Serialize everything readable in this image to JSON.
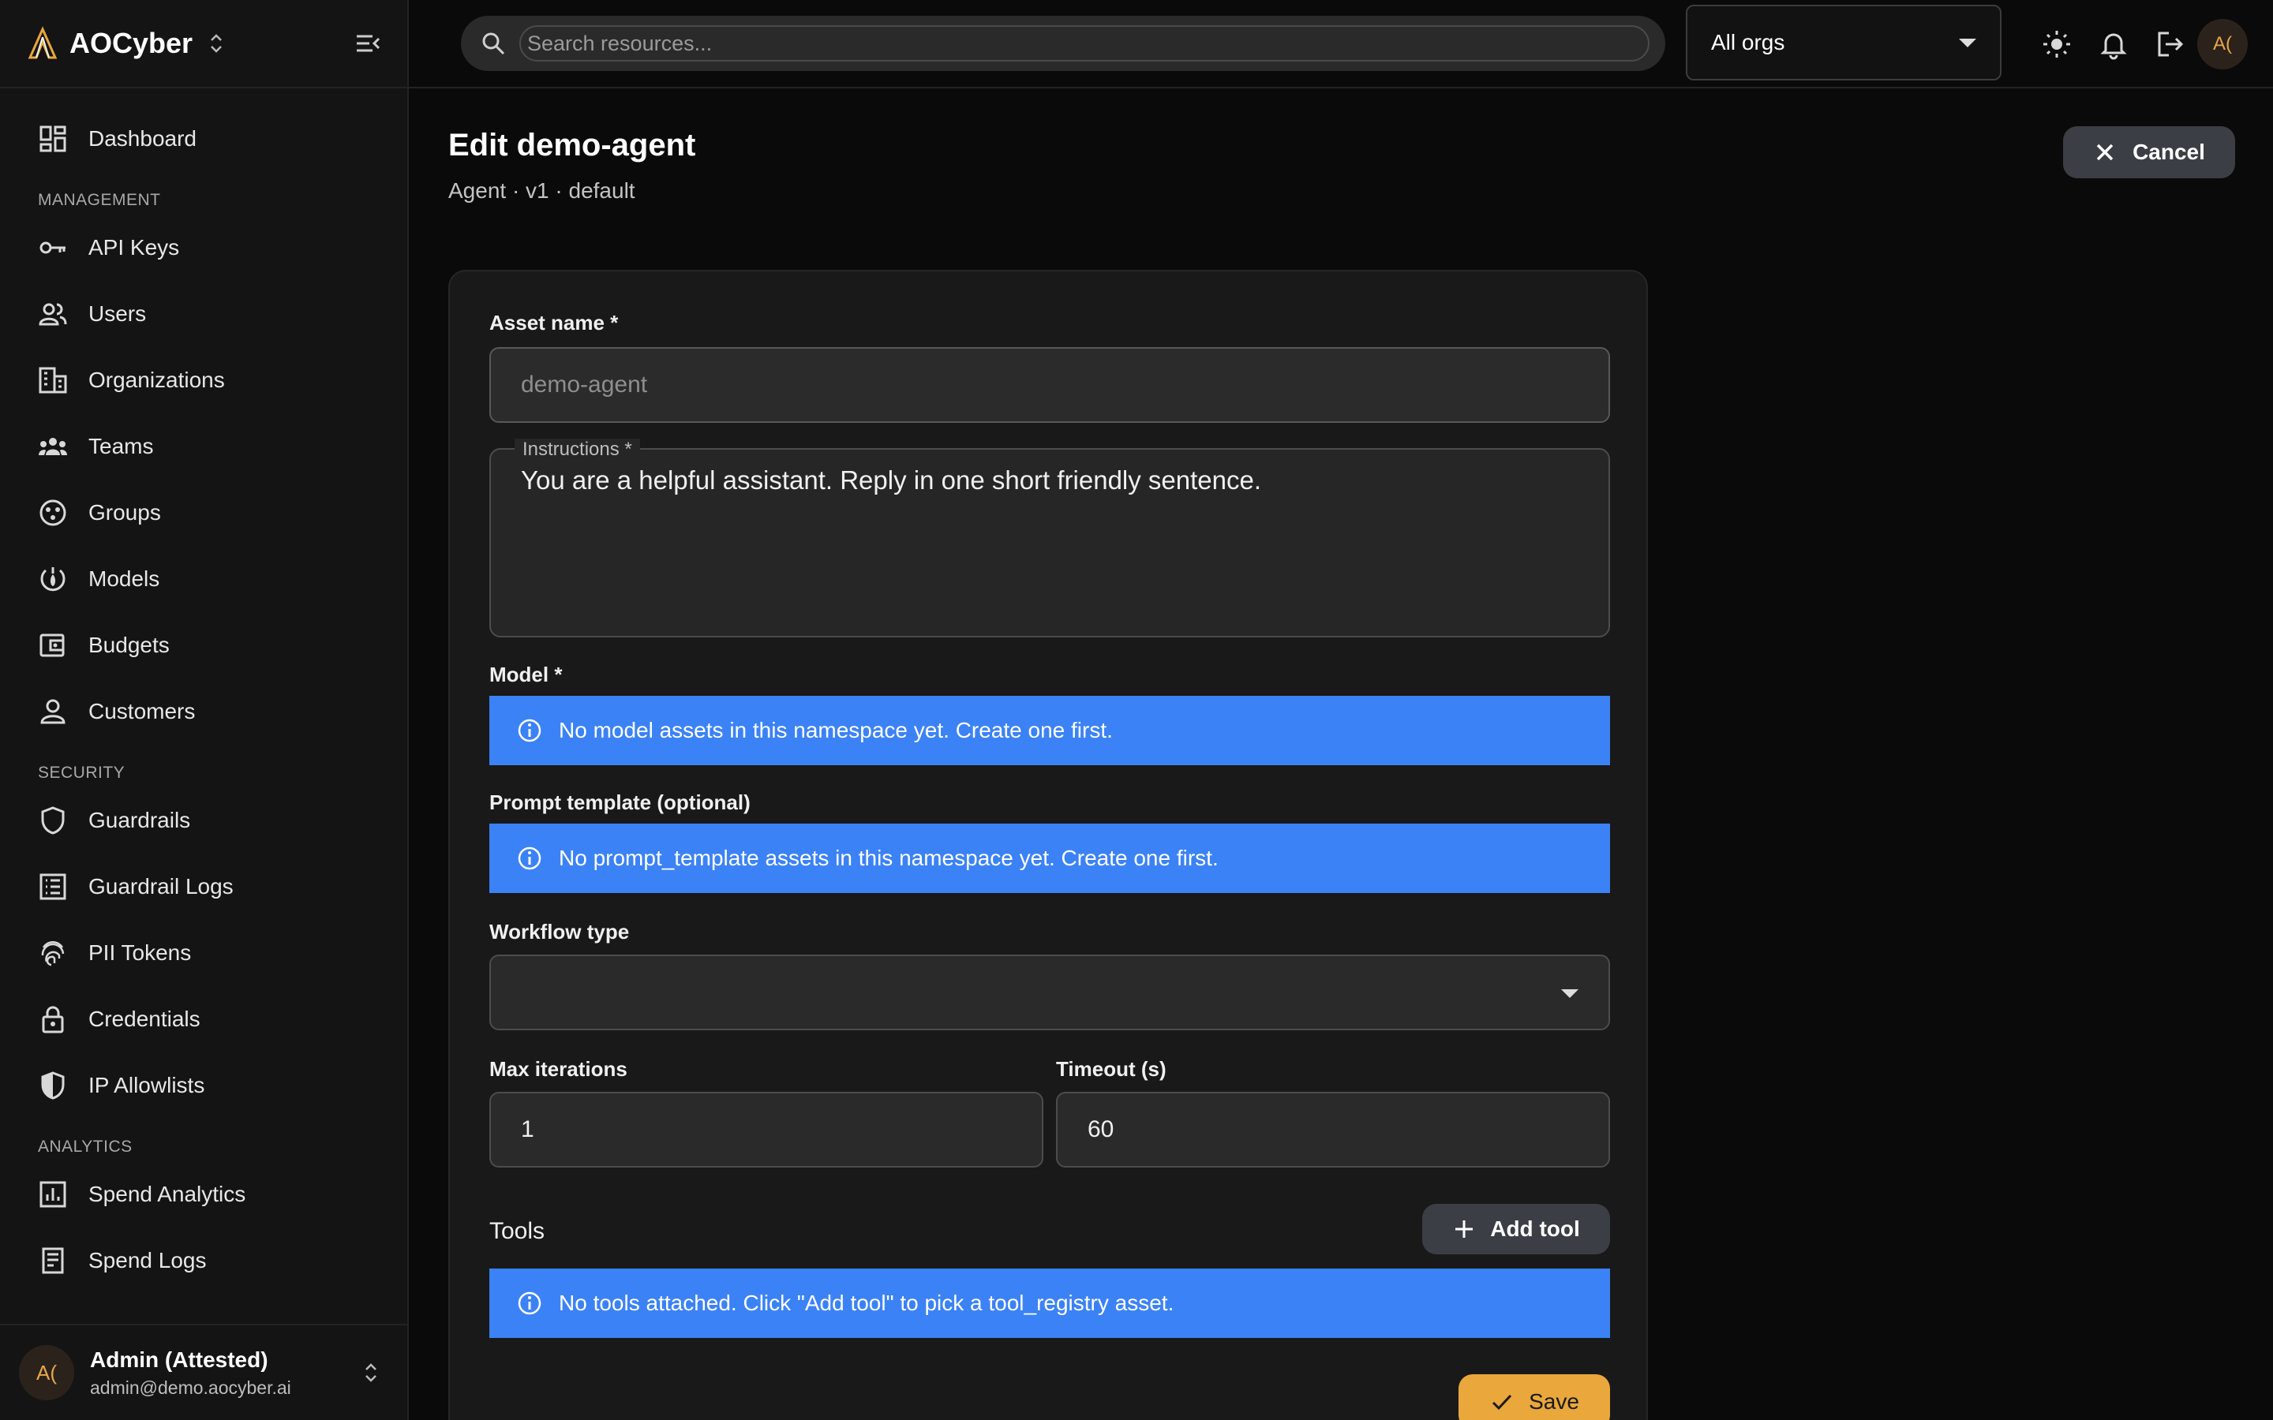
{
  "brand": {
    "name": "AOCyber",
    "switch_icon": "chevron-up-down-icon"
  },
  "sidebar": {
    "items": [
      {
        "label": "Dashboard",
        "icon": "dashboard-icon"
      }
    ],
    "sections": [
      {
        "title": "MANAGEMENT",
        "items": [
          {
            "label": "API Keys",
            "icon": "key-icon"
          },
          {
            "label": "Users",
            "icon": "users-icon"
          },
          {
            "label": "Organizations",
            "icon": "building-icon"
          },
          {
            "label": "Teams",
            "icon": "team-icon"
          },
          {
            "label": "Groups",
            "icon": "groups-icon"
          },
          {
            "label": "Models",
            "icon": "model-icon"
          },
          {
            "label": "Budgets",
            "icon": "wallet-icon"
          },
          {
            "label": "Customers",
            "icon": "person-icon"
          }
        ]
      },
      {
        "title": "SECURITY",
        "items": [
          {
            "label": "Guardrails",
            "icon": "shield-icon"
          },
          {
            "label": "Guardrail Logs",
            "icon": "list-icon"
          },
          {
            "label": "PII Tokens",
            "icon": "fingerprint-icon"
          },
          {
            "label": "Credentials",
            "icon": "lock-icon"
          },
          {
            "label": "IP Allowlists",
            "icon": "shield-half-icon"
          }
        ]
      },
      {
        "title": "ANALYTICS",
        "items": [
          {
            "label": "Spend Analytics",
            "icon": "bar-chart-icon"
          },
          {
            "label": "Spend Logs",
            "icon": "receipt-icon"
          }
        ]
      }
    ],
    "user": {
      "initials": "A(",
      "name": "Admin (Attested)",
      "email": "admin@demo.aocyber.ai"
    }
  },
  "topbar": {
    "search_placeholder": "Search resources...",
    "org_select": "All orgs",
    "avatar_initials": "A("
  },
  "page": {
    "title": "Edit demo-agent",
    "subtitle": "Agent · v1 · default",
    "cancel_label": "Cancel"
  },
  "form": {
    "asset_name": {
      "label": "Asset name *",
      "value": "demo-agent"
    },
    "instructions": {
      "label": "Instructions *",
      "value": "You are a helpful assistant. Reply in one short friendly sentence."
    },
    "model": {
      "label": "Model *",
      "alert": "No model assets in this namespace yet. Create one first."
    },
    "prompt_template": {
      "label": "Prompt template (optional)",
      "alert": "No prompt_template assets in this namespace yet. Create one first."
    },
    "workflow_type": {
      "label": "Workflow type",
      "value": ""
    },
    "max_iterations": {
      "label": "Max iterations",
      "value": "1"
    },
    "timeout": {
      "label": "Timeout (s)",
      "value": "60"
    },
    "tools": {
      "title": "Tools",
      "add_label": "Add tool",
      "alert": "No tools attached. Click \"Add tool\" to pick a tool_registry asset."
    },
    "save_label": "Save"
  },
  "colors": {
    "accent": "#e9a73c",
    "info": "#3b82f6",
    "background": "#0a0a0a",
    "sidebar": "#141414"
  }
}
